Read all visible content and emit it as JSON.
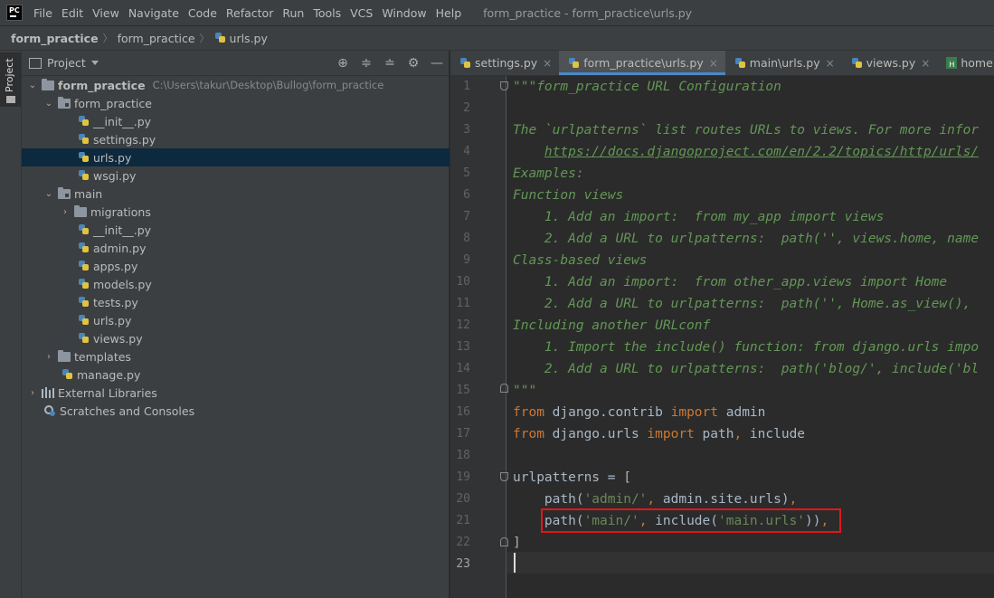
{
  "menu": {
    "logo": "PC",
    "items": [
      "File",
      "Edit",
      "View",
      "Navigate",
      "Code",
      "Refactor",
      "Run",
      "Tools",
      "VCS",
      "Window",
      "Help"
    ],
    "window_title": "form_practice - form_practice\\urls.py"
  },
  "breadcrumbs": [
    "form_practice",
    "form_practice",
    "urls.py"
  ],
  "toolstrip": {
    "project_label": "Project"
  },
  "project_panel": {
    "title": "Project",
    "tree": [
      {
        "label": "form_practice",
        "path": "C:\\Users\\takur\\Desktop\\Bullog\\form_practice"
      },
      {
        "label": "form_practice"
      },
      {
        "label": "__init__.py"
      },
      {
        "label": "settings.py"
      },
      {
        "label": "urls.py"
      },
      {
        "label": "wsgi.py"
      },
      {
        "label": "main"
      },
      {
        "label": "migrations"
      },
      {
        "label": "__init__.py"
      },
      {
        "label": "admin.py"
      },
      {
        "label": "apps.py"
      },
      {
        "label": "models.py"
      },
      {
        "label": "tests.py"
      },
      {
        "label": "urls.py"
      },
      {
        "label": "views.py"
      },
      {
        "label": "templates"
      },
      {
        "label": "manage.py"
      },
      {
        "label": "External Libraries"
      },
      {
        "label": "Scratches and Consoles"
      }
    ]
  },
  "editor": {
    "tabs": [
      {
        "label": "settings.py",
        "close": "×"
      },
      {
        "label": "form_practice\\urls.py",
        "close": "×"
      },
      {
        "label": "main\\urls.py",
        "close": "×"
      },
      {
        "label": "views.py",
        "close": "×"
      },
      {
        "label": "home.html"
      }
    ],
    "line_numbers": [
      "1",
      "2",
      "3",
      "4",
      "5",
      "6",
      "7",
      "8",
      "9",
      "10",
      "11",
      "12",
      "13",
      "14",
      "15",
      "16",
      "17",
      "18",
      "19",
      "20",
      "21",
      "22",
      "23"
    ],
    "code": {
      "l1": "\"\"\"form_practice URL Configuration",
      "l3": "The `urlpatterns` list routes URLs to views. For more infor",
      "l4_indent": "    ",
      "l4_link": "https://docs.djangoproject.com/en/2.2/topics/http/urls/",
      "l5": "Examples:",
      "l6": "Function views",
      "l7": "    1. Add an import:  from my_app import views",
      "l8": "    2. Add a URL to urlpatterns:  path('', views.home, name",
      "l9": "Class-based views",
      "l10": "    1. Add an import:  from other_app.views import Home",
      "l11": "    2. Add a URL to urlpatterns:  path('', Home.as_view(), ",
      "l12": "Including another URLconf",
      "l13": "    1. Import the include() function: from django.urls impo",
      "l14": "    2. Add a URL to urlpatterns:  path('blog/', include('bl",
      "l15": "\"\"\"",
      "l16_from": "from",
      "l16_mod": " django.contrib ",
      "l16_import": "import",
      "l16_name": " admin",
      "l17_from": "from",
      "l17_mod": " django.urls ",
      "l17_import": "import",
      "l17_name1": " path",
      "l17_comma": ",",
      "l17_name2": " include",
      "l19": "urlpatterns = [",
      "l20_indent": "    path(",
      "l20_str": "'admin/'",
      "l20_comma": ",",
      "l20_rest": " admin.site.urls)",
      "l20_end": ",",
      "l21_indent": "    ",
      "l21_a": "path(",
      "l21_str1": "'main/'",
      "l21_comma": ",",
      "l21_b": " include(",
      "l21_str2": "'main.urls'",
      "l21_c": "))",
      "l21_end": ",",
      "l22": "]"
    }
  }
}
